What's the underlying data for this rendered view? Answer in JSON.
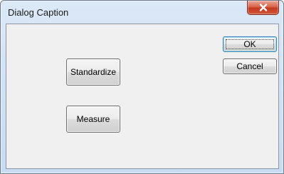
{
  "window": {
    "title": "Dialog Caption",
    "close_icon": "close-icon"
  },
  "buttons": {
    "ok": "OK",
    "cancel": "Cancel",
    "standardize": "Standardize",
    "measure": "Measure"
  }
}
